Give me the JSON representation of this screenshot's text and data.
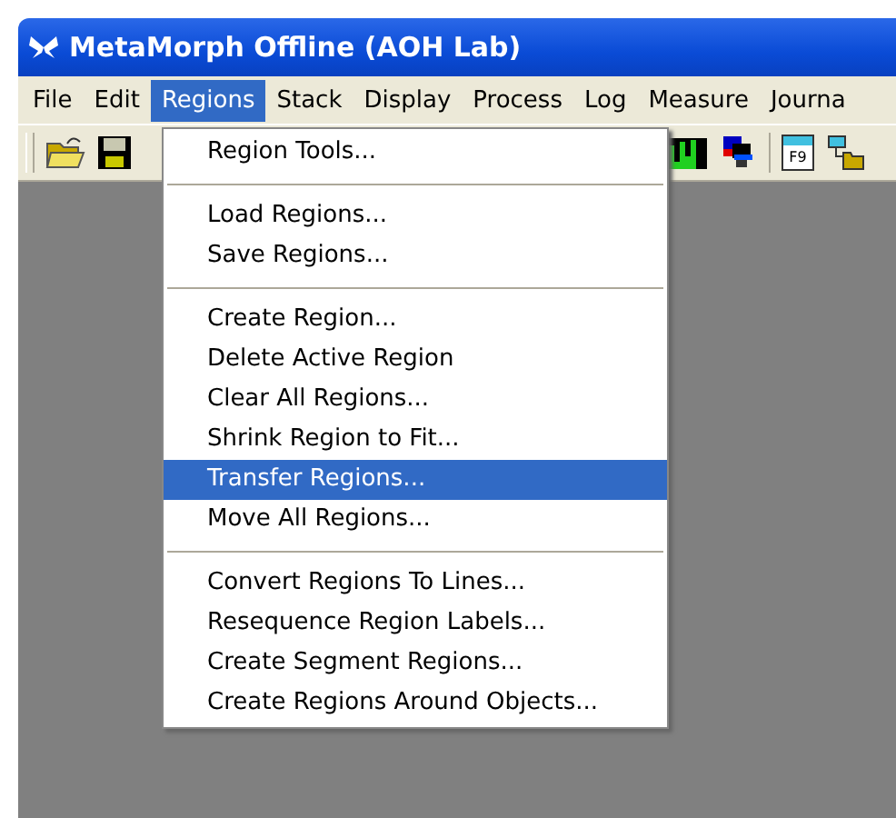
{
  "window": {
    "title": "MetaMorph Offline (AOH Lab)"
  },
  "menubar": [
    {
      "label": "File",
      "selected": false
    },
    {
      "label": "Edit",
      "selected": false
    },
    {
      "label": "Regions",
      "selected": true
    },
    {
      "label": "Stack",
      "selected": false
    },
    {
      "label": "Display",
      "selected": false
    },
    {
      "label": "Process",
      "selected": false
    },
    {
      "label": "Log",
      "selected": false
    },
    {
      "label": "Measure",
      "selected": false
    },
    {
      "label": "Journa",
      "selected": false
    }
  ],
  "toolbar": {
    "f9_key": "F9"
  },
  "menu": [
    {
      "kind": "item",
      "label": "Region Tools...",
      "selected": false
    },
    {
      "kind": "separator"
    },
    {
      "kind": "item",
      "label": "Load Regions...",
      "selected": false
    },
    {
      "kind": "item",
      "label": "Save Regions...",
      "selected": false
    },
    {
      "kind": "separator"
    },
    {
      "kind": "item",
      "label": "Create Region...",
      "selected": false
    },
    {
      "kind": "item",
      "label": "Delete Active Region",
      "selected": false
    },
    {
      "kind": "item",
      "label": "Clear All Regions...",
      "selected": false
    },
    {
      "kind": "item",
      "label": "Shrink Region to Fit...",
      "selected": false
    },
    {
      "kind": "item",
      "label": "Transfer Regions...",
      "selected": true
    },
    {
      "kind": "item",
      "label": "Move All Regions...",
      "selected": false
    },
    {
      "kind": "separator"
    },
    {
      "kind": "item",
      "label": "Convert Regions To Lines...",
      "selected": false
    },
    {
      "kind": "item",
      "label": "Resequence Region Labels...",
      "selected": false
    },
    {
      "kind": "item",
      "label": "Create Segment Regions...",
      "selected": false
    },
    {
      "kind": "item",
      "label": "Create Regions Around Objects...",
      "selected": false
    }
  ]
}
